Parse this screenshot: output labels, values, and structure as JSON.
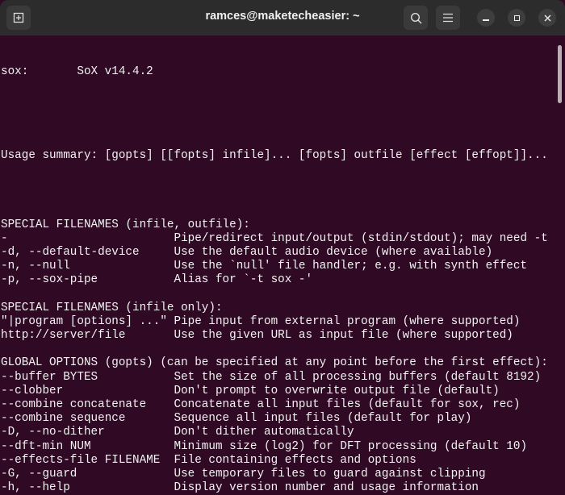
{
  "window": {
    "title": "ramces@maketecheasier: ~"
  },
  "terminal": {
    "version": {
      "opt": "sox:",
      "desc": "SoX v14.4.2"
    },
    "usage": "Usage summary: [gopts] [[fopts] infile]... [fopts] outfile [effect [effopt]]...",
    "sections": [
      {
        "heading": "SPECIAL FILENAMES (infile, outfile):",
        "items": [
          {
            "opt": "-",
            "desc": "Pipe/redirect input/output (stdin/stdout); may need -t"
          },
          {
            "opt": "-d, --default-device",
            "desc": "Use the default audio device (where available)"
          },
          {
            "opt": "-n, --null",
            "desc": "Use the `null' file handler; e.g. with synth effect"
          },
          {
            "opt": "-p, --sox-pipe",
            "desc": "Alias for `-t sox -'"
          }
        ]
      },
      {
        "heading": "SPECIAL FILENAMES (infile only):",
        "items": [
          {
            "opt": "\"|program [options] ...\"",
            "desc": "Pipe input from external program (where supported)"
          },
          {
            "opt": "http://server/file",
            "desc": "Use the given URL as input file (where supported)"
          }
        ]
      },
      {
        "heading": "GLOBAL OPTIONS (gopts) (can be specified at any point before the first effect):",
        "items": [
          {
            "opt": "--buffer BYTES",
            "desc": "Set the size of all processing buffers (default 8192)"
          },
          {
            "opt": "--clobber",
            "desc": "Don't prompt to overwrite output file (default)"
          },
          {
            "opt": "--combine concatenate",
            "desc": "Concatenate all input files (default for sox, rec)"
          },
          {
            "opt": "--combine sequence",
            "desc": "Sequence all input files (default for play)"
          },
          {
            "opt": "-D, --no-dither",
            "desc": "Don't dither automatically"
          },
          {
            "opt": "--dft-min NUM",
            "desc": "Minimum size (log2) for DFT processing (default 10)"
          },
          {
            "opt": "--effects-file FILENAME",
            "desc": "File containing effects and options"
          },
          {
            "opt": "-G, --guard",
            "desc": "Use temporary files to guard against clipping"
          },
          {
            "opt": "-h, --help",
            "desc": "Display version number and usage information"
          }
        ]
      }
    ]
  }
}
